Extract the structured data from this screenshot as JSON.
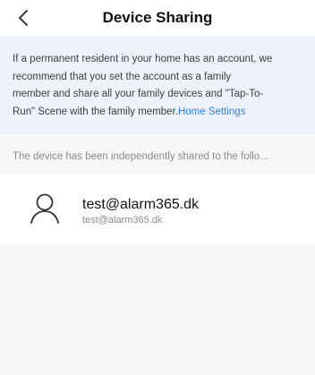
{
  "header": {
    "title": "Device Sharing",
    "back_icon": "chevron-left-icon"
  },
  "notice": {
    "lines": [
      "If a permanent resident in your home has an account, we",
      "recommend that you set the account as a family",
      "member and share all your family devices and \"Tap-To-",
      "Run\" Scene with the family member."
    ],
    "link_text": "Home Settings",
    "link_color": "#2b86e6",
    "background": "#eef3fb"
  },
  "shared_caption": "The device has been independently shared to the follo...",
  "member": {
    "avatar_icon": "user-icon",
    "name": "test@alarm365.dk",
    "account": "test@alarm365.dk"
  }
}
